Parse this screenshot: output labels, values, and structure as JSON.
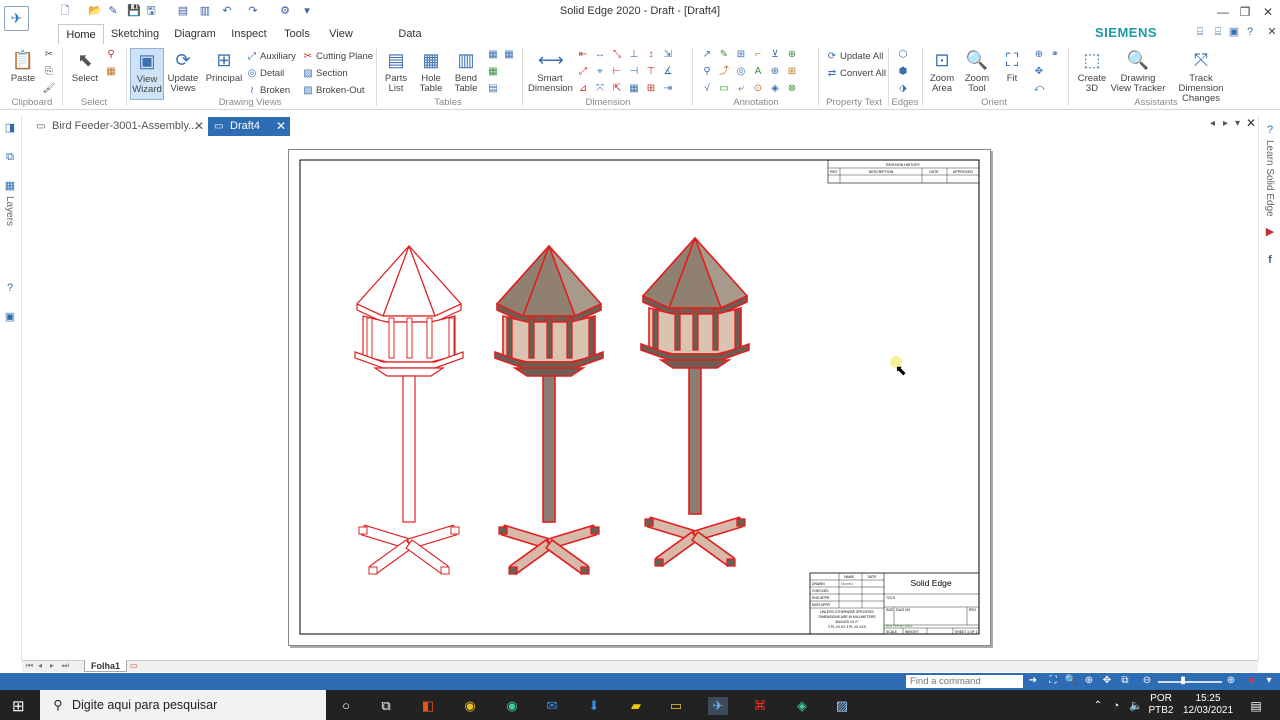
{
  "window": {
    "title": "Solid Edge 2020 - Draft - [Draft4]",
    "brand": "SIEMENS"
  },
  "ribbon_tabs": [
    {
      "label": "Home",
      "active": true
    },
    {
      "label": "Sketching"
    },
    {
      "label": "Diagram"
    },
    {
      "label": "Inspect"
    },
    {
      "label": "Tools"
    },
    {
      "label": "View"
    },
    {
      "label": "Data Management"
    }
  ],
  "ribbon": {
    "clipboard": {
      "paste": "Paste",
      "group": "Clipboard"
    },
    "select": {
      "select": "Select",
      "group": "Select"
    },
    "drawing_views": {
      "view_wizard": "View Wizard",
      "update_views": "Update Views",
      "principal": "Principal",
      "auxiliary": "Auxiliary",
      "detail": "Detail",
      "broken": "Broken",
      "cutting_plane": "Cutting Plane",
      "section": "Section",
      "broken_out": "Broken-Out",
      "group": "Drawing Views"
    },
    "tables": {
      "parts_list": "Parts List",
      "hole_table": "Hole Table",
      "bend_table": "Bend Table",
      "group": "Tables"
    },
    "dimension": {
      "smart_dimension": "Smart Dimension",
      "group": "Dimension"
    },
    "annotation": {
      "group": "Annotation"
    },
    "property_text": {
      "update_all": "Update All",
      "convert_all": "Convert All",
      "group": "Property Text"
    },
    "edges": {
      "group": "Edges"
    },
    "orient": {
      "zoom_area": "Zoom Area",
      "zoom_tool": "Zoom Tool",
      "fit": "Fit",
      "group": "Orient"
    },
    "assistants": {
      "create_3d": "Create 3D",
      "drawing_view_tracker": "Drawing View Tracker",
      "track_dimension_changes": "Track Dimension Changes",
      "group": "Assistants"
    }
  },
  "doc_tabs": [
    {
      "label": "Bird Feeder-3001-Assembly..."
    },
    {
      "label": "Draft4",
      "active": true
    }
  ],
  "side_panels": {
    "left_label": "Layers",
    "right_label": "Learn Solid Edge"
  },
  "drawing": {
    "revision_header": "REVISION HISTORY",
    "revision_columns": [
      "REV",
      "DESCRIPTION",
      "DATE",
      "APPROVED"
    ],
    "title_block_company": "Solid Edge",
    "title_block_rows": [
      "DRAWN",
      "CHECKED",
      "ENG APPR",
      "MGR APPR"
    ],
    "title_block_fields": [
      "NAME",
      "DATE"
    ],
    "title_block_drawn_name": "Marcelo",
    "title_block_title": "TITLE",
    "title_block_size": "SIZE",
    "title_block_dwg": "DWG NO",
    "title_block_rev": "REV",
    "title_block_scale": "SCALE",
    "title_block_weight": "WEIGHT",
    "title_block_sheet": "SHEET 1 OF 1",
    "title_block_notes": [
      "UNLESS OTHERWISE SPECIFIED",
      "DIMENSIONS ARE IN MILLIMETERS",
      "ANGLES ±X.X°",
      "2 PL ±X.XX 3 PL ±X.XXX"
    ],
    "file_name": "Bird Feeder-3001"
  },
  "sheet_tab": "Folha1",
  "status": {
    "command_placeholder": "Find a command"
  },
  "taskbar": {
    "search_placeholder": "Digite aqui para pesquisar",
    "lang": "POR",
    "layout": "PTB2",
    "time": "15:25",
    "date": "12/03/2021"
  },
  "colors": {
    "accent": "#2e6cb3",
    "outline": "#e02020",
    "roof_fill": "#8f8070",
    "panel_fill": "#d8c4b0",
    "brand": "#1a9aa8"
  }
}
